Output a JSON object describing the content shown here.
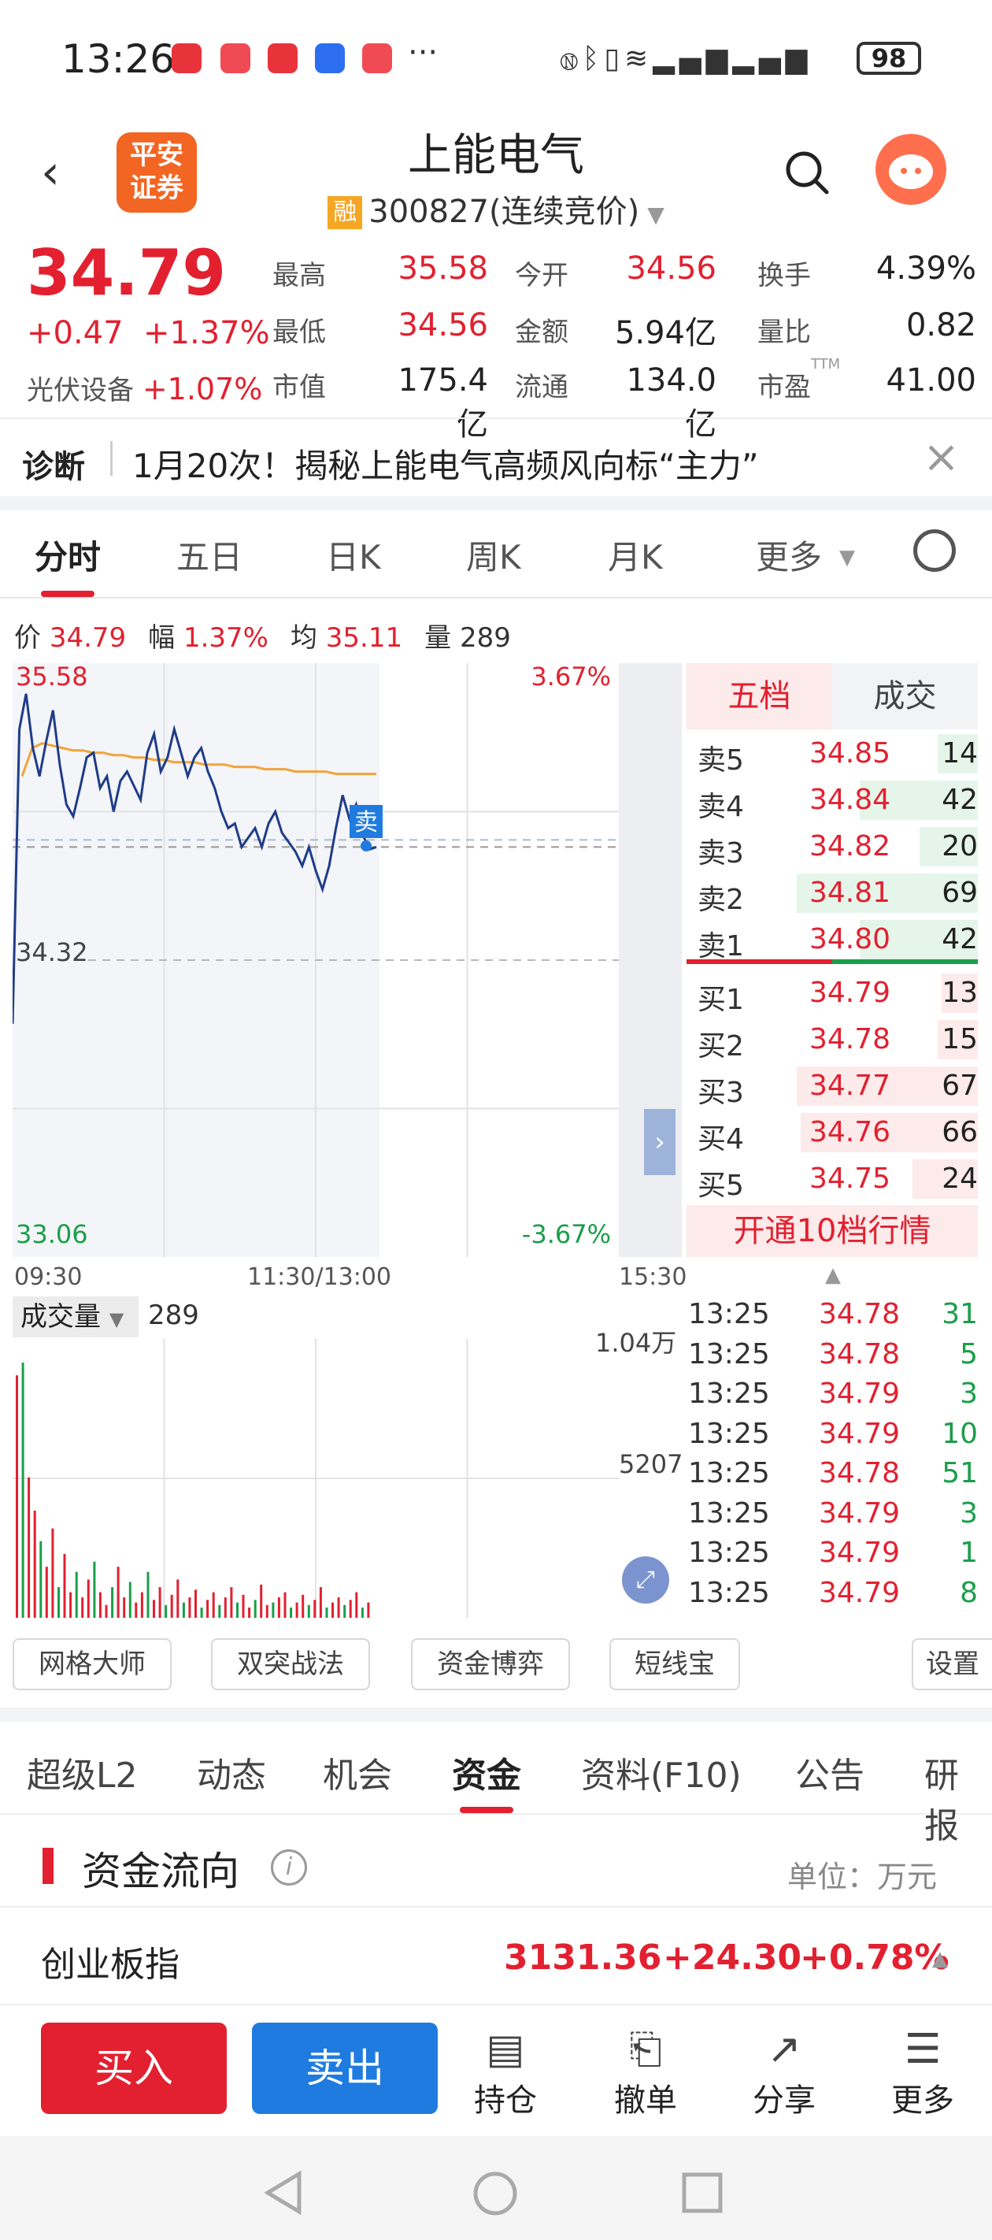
{
  "status": {
    "time": "13:26",
    "battery": "98",
    "more": "···"
  },
  "header": {
    "title": "上能电气",
    "margin_tag": "融",
    "code": "300827",
    "mode": "(连续竞价)",
    "logo_line1": "平安",
    "logo_line2": "证券"
  },
  "quote": {
    "price": "34.79",
    "change": "+0.47",
    "change_pct": "+1.37%",
    "sector_name": "光伏设备",
    "sector_pct": "+1.07%",
    "fields": [
      {
        "label": "最高",
        "value": "35.58",
        "color": "red"
      },
      {
        "label": "今开",
        "value": "34.56",
        "color": "red"
      },
      {
        "label": "换手",
        "value": "4.39%",
        "color": "black"
      },
      {
        "label": "最低",
        "value": "34.56",
        "color": "red"
      },
      {
        "label": "金额",
        "value": "5.94亿",
        "color": "black"
      },
      {
        "label": "量比",
        "value": "0.82",
        "color": "black"
      },
      {
        "label": "市值",
        "value": "175.4亿",
        "color": "black"
      },
      {
        "label": "流通",
        "value": "134.0亿",
        "color": "black"
      },
      {
        "label": "市盈",
        "value": "41.00",
        "color": "black",
        "sup": "TTM"
      }
    ]
  },
  "diagnosis": {
    "label": "诊断",
    "text": "1月20次！揭秘上能电气高频风向标“主力”"
  },
  "chart_tabs": [
    "分时",
    "五日",
    "日K",
    "周K",
    "月K",
    "更多"
  ],
  "info_line": {
    "price_label": "价",
    "price": "34.79",
    "pct_label": "幅",
    "pct": "1.37%",
    "avg_label": "均",
    "avg": "35.11",
    "vol_label": "量",
    "vol": "289"
  },
  "chart_data": {
    "type": "line",
    "y_max_label": "35.58",
    "y_mid_label": "34.32",
    "y_min_label": "33.06",
    "pct_top": "3.67%",
    "pct_bottom": "-3.67%",
    "x_labels": [
      "09:30",
      "11:30/13:00",
      "15:30"
    ],
    "ylim": [
      33.06,
      35.58
    ],
    "price_series": [
      34.05,
      35.3,
      35.45,
      35.22,
      35.1,
      35.25,
      35.38,
      35.15,
      34.98,
      34.93,
      35.05,
      35.18,
      35.2,
      35.05,
      35.1,
      34.95,
      35.08,
      35.12,
      35.06,
      35.0,
      35.2,
      35.28,
      35.12,
      35.18,
      35.3,
      35.2,
      35.1,
      35.18,
      35.22,
      35.12,
      35.05,
      34.95,
      34.88,
      34.9,
      34.8,
      34.84,
      34.88,
      34.8,
      34.9,
      34.95,
      34.86,
      34.82,
      34.78,
      34.72,
      34.8,
      34.7,
      34.62,
      34.72,
      34.88,
      35.02,
      34.92,
      34.98,
      34.85,
      34.79,
      34.8
    ],
    "avg_series": [
      35.1,
      35.22,
      35.24,
      35.23,
      35.22,
      35.21,
      35.21,
      35.2,
      35.2,
      35.19,
      35.19,
      35.18,
      35.18,
      35.17,
      35.17,
      35.16,
      35.16,
      35.16,
      35.15,
      35.15,
      35.15,
      35.14,
      35.14,
      35.14,
      35.13,
      35.13,
      35.13,
      35.12,
      35.12,
      35.12,
      35.12,
      35.11,
      35.11,
      35.11,
      35.11,
      35.11
    ],
    "sell_marker": "卖",
    "volume_label": "成交量",
    "volume": "289",
    "vol_max_label": "1.04万",
    "vol_mid_label": "5207",
    "volume_series": [
      0.95,
      1.0,
      0.55,
      0.42,
      0.3,
      0.2,
      0.35,
      0.12,
      0.25,
      0.1,
      0.18,
      0.08,
      0.15,
      0.22,
      0.1,
      0.05,
      0.12,
      0.2,
      0.08,
      0.14,
      0.06,
      0.1,
      0.18,
      0.07,
      0.12,
      0.05,
      0.09,
      0.15,
      0.06,
      0.08,
      0.11,
      0.04,
      0.07,
      0.1,
      0.05,
      0.08,
      0.12,
      0.06,
      0.09,
      0.04,
      0.07,
      0.13,
      0.05,
      0.06,
      0.08,
      0.1,
      0.04,
      0.06,
      0.09,
      0.05,
      0.07,
      0.12,
      0.04,
      0.06,
      0.08,
      0.05,
      0.07,
      0.1,
      0.04,
      0.06
    ]
  },
  "orderbook": {
    "tab_active": "五档",
    "tab_other": "成交",
    "asks": [
      {
        "label": "卖5",
        "price": "34.85",
        "vol": "14",
        "fill": 0.22
      },
      {
        "label": "卖4",
        "price": "34.84",
        "vol": "42",
        "fill": 0.65
      },
      {
        "label": "卖3",
        "price": "34.82",
        "vol": "20",
        "fill": 0.32
      },
      {
        "label": "卖2",
        "price": "34.81",
        "vol": "69",
        "fill": 1.0
      },
      {
        "label": "卖1",
        "price": "34.80",
        "vol": "42",
        "fill": 0.65
      }
    ],
    "bids": [
      {
        "label": "买1",
        "price": "34.79",
        "vol": "13",
        "fill": 0.2
      },
      {
        "label": "买2",
        "price": "34.78",
        "vol": "15",
        "fill": 0.22
      },
      {
        "label": "买3",
        "price": "34.77",
        "vol": "67",
        "fill": 1.0
      },
      {
        "label": "买4",
        "price": "34.76",
        "vol": "66",
        "fill": 0.98
      },
      {
        "label": "买5",
        "price": "34.75",
        "vol": "24",
        "fill": 0.36
      }
    ],
    "open10": "开通10档行情"
  },
  "ticks": [
    {
      "time": "13:25",
      "price": "34.78",
      "vol": "31"
    },
    {
      "time": "13:25",
      "price": "34.78",
      "vol": "5"
    },
    {
      "time": "13:25",
      "price": "34.79",
      "vol": "3"
    },
    {
      "time": "13:25",
      "price": "34.79",
      "vol": "10"
    },
    {
      "time": "13:25",
      "price": "34.78",
      "vol": "51"
    },
    {
      "time": "13:25",
      "price": "34.79",
      "vol": "3"
    },
    {
      "time": "13:25",
      "price": "34.79",
      "vol": "1"
    },
    {
      "time": "13:25",
      "price": "34.79",
      "vol": "8"
    }
  ],
  "tools": [
    "网格大师",
    "双突战法",
    "资金博弈",
    "短线宝",
    "设置"
  ],
  "section_tabs": [
    "超级L2",
    "动态",
    "机会",
    "资金",
    "资料(F10)",
    "公告",
    "研报"
  ],
  "flow": {
    "title": "资金流向",
    "info": "i",
    "unit": "单位：万元"
  },
  "index": {
    "name": "创业板指",
    "value": "3131.36",
    "change": "+24.30",
    "pct": "+0.78%"
  },
  "bottom": {
    "buy": "买入",
    "sell": "卖出",
    "hold": "持仓",
    "cancel": "撤单",
    "share": "分享",
    "more": "更多"
  },
  "colors": {
    "red": "#e2202f",
    "green": "#1a9e4a",
    "blue": "#1f7be0",
    "price_line": "#1f3c88",
    "avg_line": "#f0a43a"
  }
}
